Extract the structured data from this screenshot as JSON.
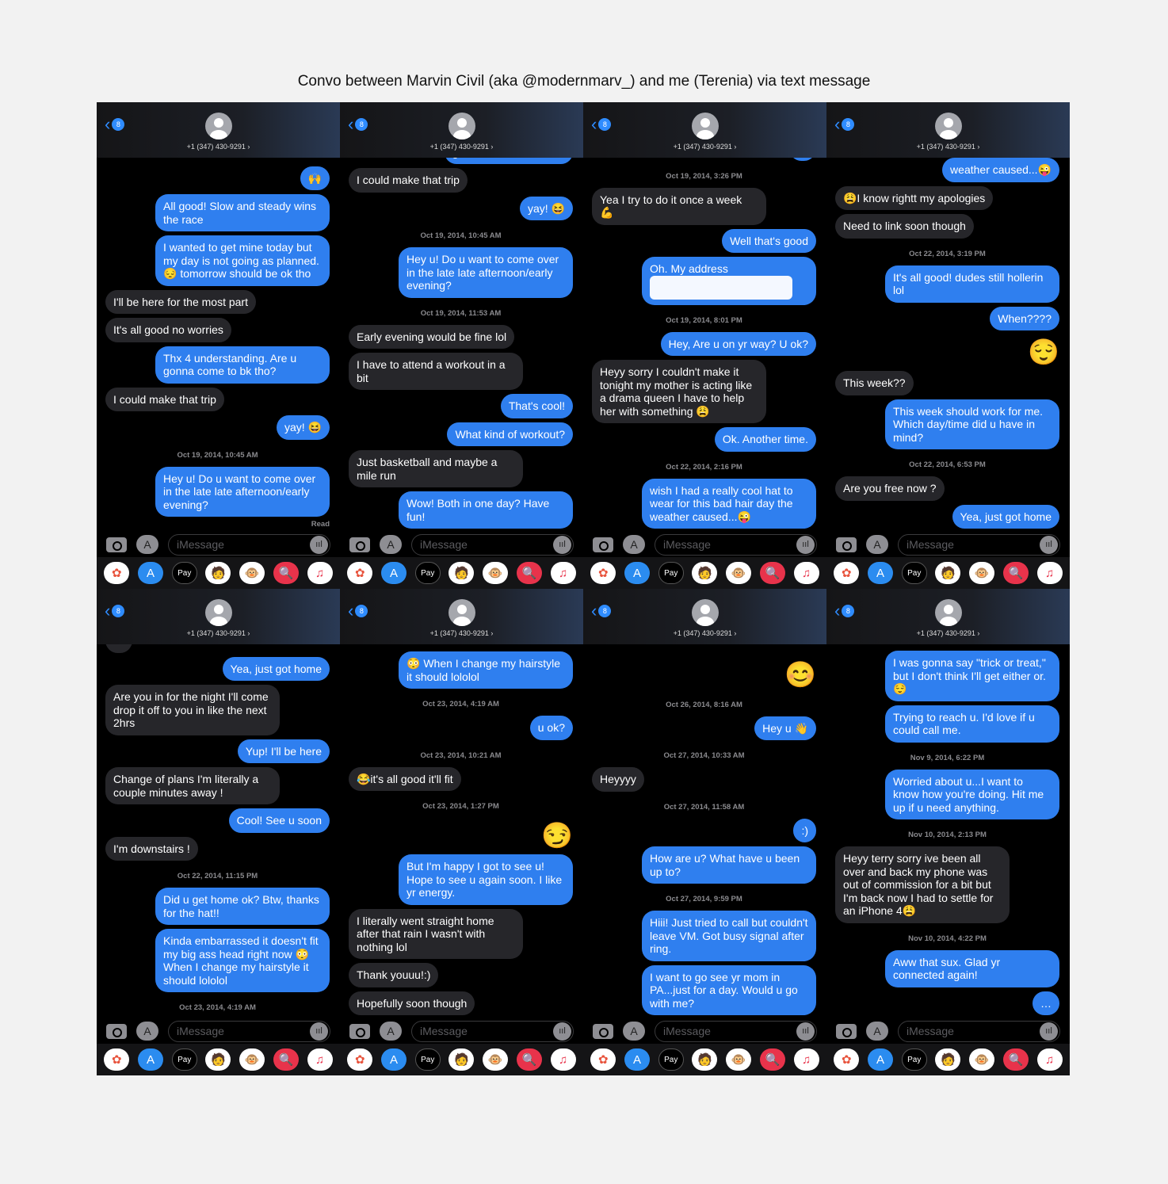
{
  "title": "Convo between Marvin Civil (aka @modernmarv_) and me (Terenia) via text message",
  "header": {
    "back_badge": "8",
    "contact": "+1 (347) 430-9291 ›"
  },
  "composer": {
    "placeholder": "iMessage"
  },
  "app_drawer": [
    {
      "icon": "photos-icon",
      "glyph": "✿",
      "bg": "#ffffff",
      "fg": "#e8533c"
    },
    {
      "icon": "app-store-icon",
      "glyph": "A",
      "bg": "#2b8cf0",
      "fg": "#ffffff"
    },
    {
      "icon": "apple-pay-icon",
      "glyph": "Pay",
      "bg": "#000000",
      "fg": "#ffffff"
    },
    {
      "icon": "memoji-icon",
      "glyph": "🧑",
      "bg": "#ffffff",
      "fg": "#000000"
    },
    {
      "icon": "animoji-monkey-icon",
      "glyph": "🐵",
      "bg": "#ffffff",
      "fg": "#000000"
    },
    {
      "icon": "web-search-icon",
      "glyph": "🔍",
      "bg": "#e8334b",
      "fg": "#ffffff"
    },
    {
      "icon": "music-icon",
      "glyph": "♫",
      "bg": "#ffffff",
      "fg": "#e8334b"
    }
  ],
  "colors": {
    "sent": "#2f7fef",
    "received": "#26262a",
    "accent": "#2f8cff"
  },
  "panels": [
    [
      {
        "k": "s",
        "x": "🙌"
      },
      {
        "k": "s",
        "x": "All good! Slow and steady wins the race"
      },
      {
        "k": "s",
        "x": "I wanted to get mine today but my day is not going as planned. 😔 tomorrow should be ok tho"
      },
      {
        "k": "r",
        "x": "I'll be here for the most part"
      },
      {
        "k": "r",
        "x": "It's all good no worries"
      },
      {
        "k": "s",
        "x": "Thx 4 understanding. Are u gonna come to bk tho?"
      },
      {
        "k": "r",
        "x": "I could make that trip"
      },
      {
        "k": "s",
        "x": "yay! 😆"
      },
      {
        "k": "t",
        "x": "Oct 19, 2014, 10:45 AM"
      },
      {
        "k": "s",
        "x": "Hey u! Do u want to come over in the late late afternoon/early evening?"
      },
      {
        "k": "rd",
        "x": "Read"
      }
    ],
    [
      {
        "k": "s",
        "x": "gonna come to bk tho?"
      },
      {
        "k": "r",
        "x": "I could make that trip"
      },
      {
        "k": "s",
        "x": "yay! 😆"
      },
      {
        "k": "t",
        "x": "Oct 19, 2014, 10:45 AM"
      },
      {
        "k": "s",
        "x": "Hey u! Do u want to come over in the late late afternoon/early evening?"
      },
      {
        "k": "t",
        "x": "Oct 19, 2014, 11:53 AM"
      },
      {
        "k": "r",
        "x": "Early evening would be fine lol"
      },
      {
        "k": "r",
        "x": "I have to attend a workout in a bit"
      },
      {
        "k": "s",
        "x": "That's cool!"
      },
      {
        "k": "s",
        "x": "What kind of workout?"
      },
      {
        "k": "r",
        "x": "Just basketball and maybe a mile run"
      },
      {
        "k": "s",
        "x": "Wow! Both in one day? Have fun!"
      }
    ],
    [
      {
        "k": "s",
        "x": "…"
      },
      {
        "k": "t",
        "x": "Oct 19, 2014, 3:26 PM"
      },
      {
        "k": "r",
        "x": "Yea I try to do it once a week 💪"
      },
      {
        "k": "s",
        "x": "Well that's good"
      },
      {
        "k": "s",
        "x": "Oh. My address",
        "redacted": true
      },
      {
        "k": "t",
        "x": "Oct 19, 2014, 8:01 PM"
      },
      {
        "k": "s",
        "x": "Hey, Are u on yr way? U ok?"
      },
      {
        "k": "r",
        "x": "Heyy sorry I couldn't make it tonight my mother is acting like a drama queen I have to help her with something 😩"
      },
      {
        "k": "s",
        "x": "Ok. Another time."
      },
      {
        "k": "t",
        "x": "Oct 22, 2014, 2:16 PM"
      },
      {
        "k": "s",
        "x": "wish I had a really cool hat to wear for this bad hair day the weather caused...😜"
      }
    ],
    [
      {
        "k": "s",
        "x": "weather caused...😜"
      },
      {
        "k": "r",
        "x": "😩I know rightt my apologies"
      },
      {
        "k": "r",
        "x": "Need to link soon though"
      },
      {
        "k": "t",
        "x": "Oct 22, 2014, 3:19 PM"
      },
      {
        "k": "s",
        "x": "It's all good! dudes still hollerin lol"
      },
      {
        "k": "s",
        "x": "When????"
      },
      {
        "k": "big",
        "x": "😌"
      },
      {
        "k": "r",
        "x": "This week??"
      },
      {
        "k": "s",
        "x": "This week should work for me. Which day/time did u have in mind?"
      },
      {
        "k": "t",
        "x": "Oct 22, 2014, 6:53 PM"
      },
      {
        "k": "r",
        "x": "Are you free now ?"
      },
      {
        "k": "s",
        "x": "Yea, just got home"
      }
    ],
    [
      {
        "k": "r",
        "x": "…"
      },
      {
        "k": "s",
        "x": "Yea, just got home"
      },
      {
        "k": "r",
        "x": "Are you in for the night I'll come drop it off to you in like the next 2hrs"
      },
      {
        "k": "s",
        "x": "Yup! I'll be here"
      },
      {
        "k": "r",
        "x": "Change of plans I'm literally a couple minutes away !"
      },
      {
        "k": "s",
        "x": "Cool! See u soon"
      },
      {
        "k": "r",
        "x": "I'm downstairs !"
      },
      {
        "k": "t",
        "x": "Oct 22, 2014, 11:15 PM"
      },
      {
        "k": "s",
        "x": "Did u get home ok? Btw, thanks for the hat!!"
      },
      {
        "k": "s",
        "x": "Kinda embarrassed it doesn't fit my big ass head right now 😳 When I change my hairstyle it should lololol"
      },
      {
        "k": "t",
        "x": "Oct 23, 2014, 4:19 AM"
      }
    ],
    [
      {
        "k": "s",
        "x": "😳 When I change my hairstyle it should lololol"
      },
      {
        "k": "t",
        "x": "Oct 23, 2014, 4:19 AM"
      },
      {
        "k": "s",
        "x": "u ok?"
      },
      {
        "k": "t",
        "x": "Oct 23, 2014, 10:21 AM"
      },
      {
        "k": "r",
        "x": "😂it's all good it'll fit"
      },
      {
        "k": "t",
        "x": "Oct 23, 2014, 1:27 PM"
      },
      {
        "k": "big",
        "x": "😏"
      },
      {
        "k": "s",
        "x": "But I'm happy I got to see u! Hope to see u again soon. I like yr energy."
      },
      {
        "k": "r",
        "x": "I literally went straight home after that rain I wasn't with nothing lol"
      },
      {
        "k": "r",
        "x": "Thank youuu!:)"
      },
      {
        "k": "r",
        "x": "Hopefully soon though"
      }
    ],
    [
      {
        "k": "big",
        "x": "😊"
      },
      {
        "k": "t",
        "x": "Oct 26, 2014, 8:16 AM"
      },
      {
        "k": "s",
        "x": "Hey u 👋"
      },
      {
        "k": "t",
        "x": "Oct 27, 2014, 10:33 AM"
      },
      {
        "k": "r",
        "x": "Heyyyy"
      },
      {
        "k": "t",
        "x": "Oct 27, 2014, 11:58 AM"
      },
      {
        "k": "s",
        "x": ":)"
      },
      {
        "k": "s",
        "x": "How are u? What have u been up to?"
      },
      {
        "k": "t",
        "x": "Oct 27, 2014, 9:59 PM"
      },
      {
        "k": "s",
        "x": "Hiii! Just tried to call but couldn't leave VM. Got busy signal after ring."
      },
      {
        "k": "s",
        "x": "I want to go see yr mom in PA...just for a day. Would u go with me?"
      }
    ],
    [
      {
        "k": "s",
        "x": "with me?"
      },
      {
        "k": "t",
        "x": "Oct 31, 2014, 4:52 PM"
      },
      {
        "k": "s",
        "x": "I was gonna say \"trick or treat,\" but I don't think I'll get either or. 😌"
      },
      {
        "k": "s",
        "x": "Trying to reach u. I'd love if u could call me."
      },
      {
        "k": "t",
        "x": "Nov 9, 2014, 6:22 PM"
      },
      {
        "k": "s",
        "x": "Worried about u...I want to know how you're doing. Hit me up if u need anything."
      },
      {
        "k": "t",
        "x": "Nov 10, 2014, 2:13 PM"
      },
      {
        "k": "r",
        "x": "Heyy terry sorry ive been all over and back my phone was out of commission for a bit but I'm back now I had to settle for an iPhone 4😩"
      },
      {
        "k": "t",
        "x": "Nov 10, 2014, 4:22 PM"
      },
      {
        "k": "s",
        "x": "Aww that sux. Glad yr connected again!"
      },
      {
        "k": "s",
        "x": "…"
      }
    ]
  ]
}
